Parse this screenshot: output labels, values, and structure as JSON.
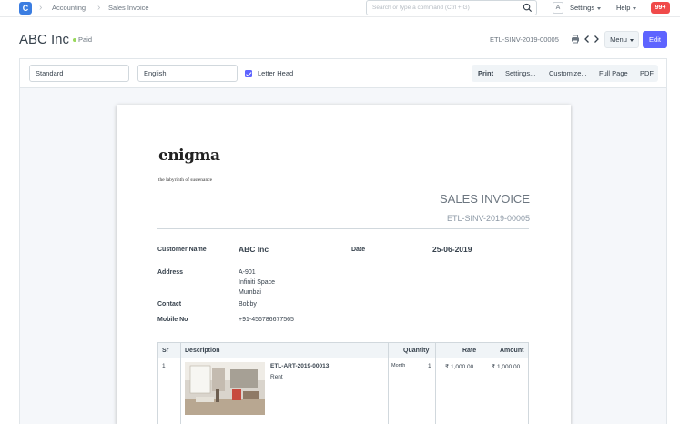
{
  "navbar": {
    "logo_letter": "C",
    "breadcrumbs": [
      "Accounting",
      "Sales Invoice"
    ],
    "search_placeholder": "Search or type a command (Ctrl + G)",
    "avatar_letter": "A",
    "settings_label": "Settings",
    "help_label": "Help",
    "notification_count": "99+"
  },
  "page": {
    "title": "ABC Inc",
    "status": "Paid",
    "document_id": "ETL-SINV-2019-00005",
    "menu_label": "Menu",
    "edit_label": "Edit"
  },
  "print_toolbar": {
    "format": "Standard",
    "language": "English",
    "letter_head_label": "Letter Head",
    "letter_head_checked": true,
    "buttons": [
      "Print",
      "Settings...",
      "Customize...",
      "Full Page",
      "PDF"
    ]
  },
  "invoice": {
    "brand": "enigma",
    "tagline": "the labyrinth of sustenance",
    "heading": "SALES INVOICE",
    "number": "ETL-SINV-2019-00005",
    "fields": {
      "customer_name_label": "Customer Name",
      "customer_name": "ABC Inc",
      "date_label": "Date",
      "date": "25-06-2019",
      "address_label": "Address",
      "address_lines": [
        "A-901",
        "Infiniti Space",
        "Mumbai"
      ],
      "contact_label": "Contact",
      "contact": "Bobby",
      "mobile_label": "Mobile No",
      "mobile": "+91-456786677565"
    },
    "items_table": {
      "headers": [
        "Sr",
        "Description",
        "Quantity",
        "Rate",
        "Amount"
      ],
      "rows": [
        {
          "sr": "1",
          "item_code": "ETL-ART-2019-00013",
          "item_desc": "Rent",
          "uom": "Month",
          "qty": "1",
          "rate": "₹ 1,000.00",
          "amount": "₹ 1,000.00"
        }
      ]
    }
  },
  "colors": {
    "brand_blue": "#3b7de1",
    "primary": "#5e64ff",
    "paid_green": "#98d85b",
    "badge_red": "#f04a4a"
  }
}
